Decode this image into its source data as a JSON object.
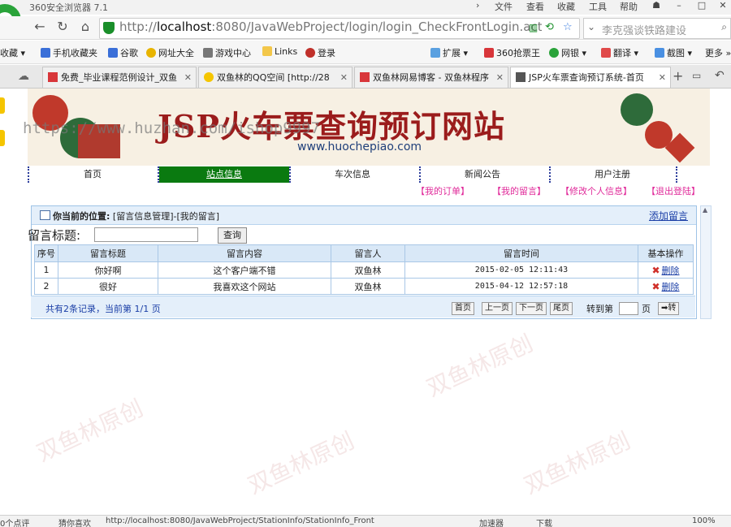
{
  "browser": {
    "app_title": "360安全浏览器 7.1",
    "menu": [
      "文件",
      "查看",
      "收藏",
      "工具",
      "帮助"
    ],
    "address": {
      "scheme": "http://",
      "host": "localhost",
      "path": ":8080/JavaWebProject/login/login_CheckFrontLogin.actic"
    },
    "search_placeholder": "李克强谈铁路建设",
    "bookmarks": [
      {
        "label": "收藏"
      },
      {
        "label": "手机收藏夹"
      },
      {
        "label": "谷歌"
      },
      {
        "label": "网址大全"
      },
      {
        "label": "游戏中心"
      },
      {
        "label": "Links"
      },
      {
        "label": "登录"
      },
      {
        "label": "扩展"
      },
      {
        "label": "360抢票王"
      },
      {
        "label": "网银"
      },
      {
        "label": "翻译"
      },
      {
        "label": "截图"
      },
      {
        "label": "更多"
      }
    ],
    "tabs": [
      {
        "label": "免费_毕业课程范例设计_双鱼"
      },
      {
        "label": "双鱼林的QQ空间 [http://28"
      },
      {
        "label": "双鱼林网易博客 - 双鱼林程序"
      },
      {
        "label": "JSP火车票查询预订系统-首页"
      }
    ],
    "status": {
      "left": "0个点评",
      "news": "猜你喜欢",
      "url": "http://localhost:8080/JavaWebProject/StationInfo/StationInfo_Front",
      "accel": "加速器",
      "download": "下载",
      "zoom": "100%"
    }
  },
  "site": {
    "title": "JSP火车票查询预订网站",
    "domain": "www.huochepiao.com",
    "watermark": "https://www.huzhan.com/ishop9997",
    "nav": [
      "首页",
      "站点信息",
      "车次信息",
      "新闻公告",
      "用户注册"
    ],
    "user_links": [
      "【我的订单】",
      "【我的留言】",
      "【修改个人信息】",
      "【退出登陆】"
    ]
  },
  "panel": {
    "location_label": "你当前的位置:",
    "location_path": "[留言信息管理]-[我的留言]",
    "add_link": "添加留言",
    "search_label": "留言标题:",
    "search_value": "",
    "search_button": "查询",
    "columns": [
      "序号",
      "留言标题",
      "留言内容",
      "留言人",
      "留言时间",
      "基本操作"
    ],
    "rows": [
      {
        "no": "1",
        "title": "你好啊",
        "content": "这个客户端不错",
        "user": "双鱼林",
        "time": "2015-02-05 12:11:43",
        "op": "删除"
      },
      {
        "no": "2",
        "title": "很好",
        "content": "我喜欢这个网站",
        "user": "双鱼林",
        "time": "2015-04-12 12:57:18",
        "op": "删除"
      }
    ],
    "pager": {
      "info": "共有2条记录，当前第 1/1 页",
      "first": "首页",
      "prev": "上一页",
      "next": "下一页",
      "last": "尾页",
      "goto_label": "转到第",
      "page_unit": "页",
      "go": "➡转"
    }
  },
  "watermark_text": "双鱼林原创"
}
